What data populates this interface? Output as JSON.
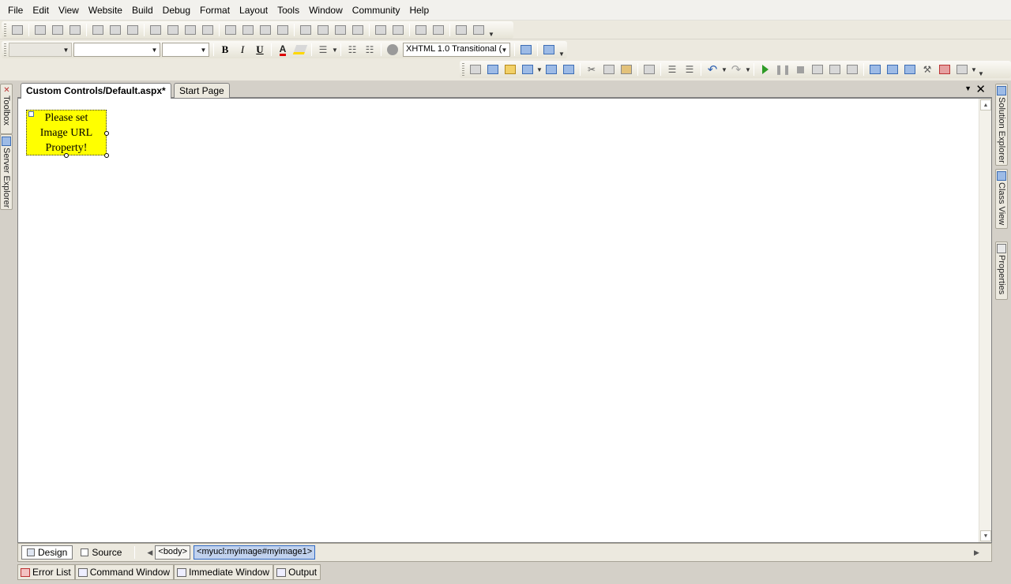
{
  "menu": [
    "File",
    "Edit",
    "View",
    "Website",
    "Build",
    "Debug",
    "Format",
    "Layout",
    "Tools",
    "Window",
    "Community",
    "Help"
  ],
  "formatting": {
    "block_format": "",
    "font_name": "",
    "font_size": "",
    "bold": "B",
    "italic": "I",
    "underline": "U",
    "doctype": "XHTML 1.0 Transitional ("
  },
  "left_tabs": [
    "Toolbox",
    "Server Explorer"
  ],
  "right_tabs": [
    "Solution Explorer",
    "Class View",
    "Properties"
  ],
  "doc_tabs": [
    {
      "label": "Custom Controls/Default.aspx*",
      "active": true
    },
    {
      "label": "Start Page",
      "active": false
    }
  ],
  "designer": {
    "control_lines": [
      "Please set",
      "Image URL",
      "Property!"
    ],
    "control_color": "#ffff00"
  },
  "viewbar": {
    "design": "Design",
    "source": "Source",
    "tags": [
      "<body>",
      "<myucl:myimage#myimage1>"
    ]
  },
  "bottom_tabs": [
    "Error List",
    "Command Window",
    "Immediate Window",
    "Output"
  ]
}
